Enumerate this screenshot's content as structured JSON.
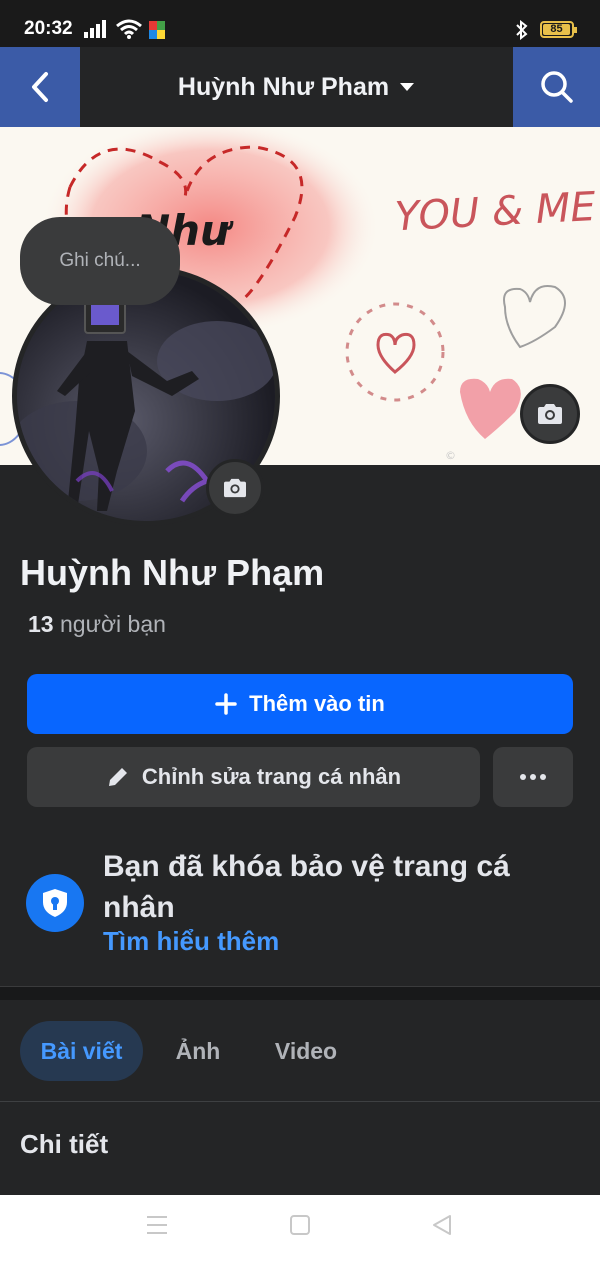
{
  "status_bar": {
    "time": "20:32",
    "battery_level": "85",
    "icons": [
      "signal-icon",
      "wifi-icon",
      "app-notification-icon",
      "bluetooth-icon",
      "battery-icon"
    ]
  },
  "header": {
    "title": "Huỳnh Như Pham",
    "back_icon": "chevron-left-icon",
    "dropdown_icon": "caret-down-icon",
    "search_icon": "search-icon"
  },
  "cover": {
    "art_text_left": "Như",
    "art_text_right": "YOU & ME",
    "camera_icon": "camera-icon"
  },
  "profile": {
    "note_placeholder": "Ghi chú...",
    "name": "Huỳnh Như Phạm",
    "friends_count": "13",
    "friends_label": "người bạn",
    "avatar_camera_icon": "camera-icon"
  },
  "actions": {
    "add_story_label": "Thêm vào tin",
    "add_story_icon": "plus-icon",
    "edit_profile_label": "Chỉnh sửa trang cá nhân",
    "edit_profile_icon": "pencil-icon",
    "more_icon": "more-horizontal-icon"
  },
  "lock_notice": {
    "title": "Bạn đã khóa bảo vệ trang cá nhân",
    "link": "Tìm hiểu thêm",
    "icon": "shield-lock-icon"
  },
  "tabs": [
    {
      "label": "Bài viết",
      "active": true
    },
    {
      "label": "Ảnh",
      "active": false
    },
    {
      "label": "Video",
      "active": false
    }
  ],
  "details": {
    "title": "Chi tiết"
  },
  "colors": {
    "background": "#242526",
    "primary_button": "#0866ff",
    "secondary_button": "#3a3b3c",
    "link": "#4599ff",
    "header_side_buttons": "#3b5ba7"
  }
}
